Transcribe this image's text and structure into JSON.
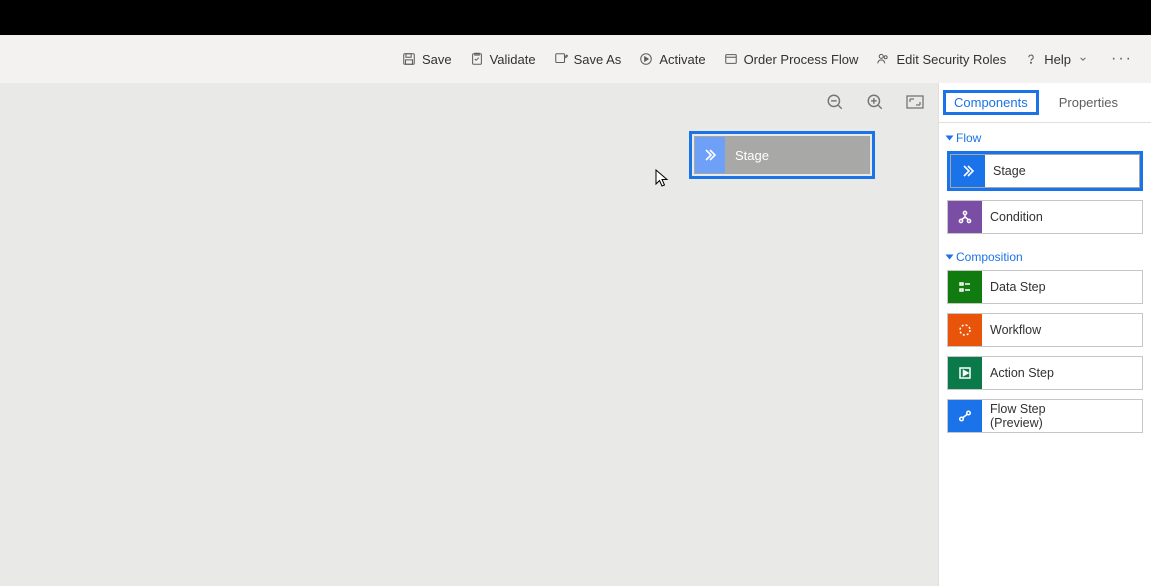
{
  "toolbar": {
    "save": "Save",
    "validate": "Validate",
    "save_as": "Save As",
    "activate": "Activate",
    "process_flow": "Order Process Flow",
    "edit_security": "Edit Security Roles",
    "help": "Help"
  },
  "canvas": {
    "dragged_stage_label": "Stage"
  },
  "panel": {
    "tabs": {
      "components": "Components",
      "properties": "Properties"
    },
    "sections": {
      "flow": {
        "title": "Flow",
        "items": {
          "stage": "Stage",
          "condition": "Condition"
        }
      },
      "composition": {
        "title": "Composition",
        "items": {
          "data_step": "Data Step",
          "workflow": "Workflow",
          "action_step": "Action Step",
          "flow_step": "Flow Step\n(Preview)"
        }
      }
    }
  }
}
